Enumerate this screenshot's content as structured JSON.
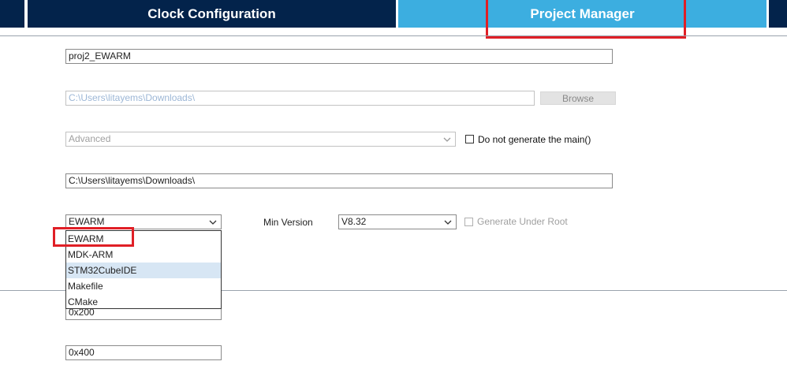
{
  "tabs": {
    "clock_configuration": "Clock Configuration",
    "project_manager": "Project Manager"
  },
  "project": {
    "name": "proj2_EWARM",
    "location": "C:\\Users\\litayems\\Downloads\\",
    "browse_label": "Browse",
    "application_structure": "Advanced",
    "do_not_generate_main_label": "Do not generate the main()",
    "do_not_generate_main_checked": false,
    "toolchain_folder": "C:\\Users\\litayems\\Downloads\\",
    "toolchain_selected": "EWARM",
    "min_version_label": "Min Version",
    "min_version_value": "V8.32",
    "generate_under_root_label": "Generate Under Root",
    "generate_under_root_checked": false,
    "toolchain_options": [
      "EWARM",
      "MDK-ARM",
      "STM32CubeIDE",
      "Makefile",
      "CMake"
    ],
    "hovered_option": "STM32CubeIDE",
    "heap_size": "0x200",
    "stack_size": "0x400"
  },
  "colors": {
    "tab_dark": "#03234b",
    "tab_active": "#3caee0",
    "highlight_red": "#e01f26",
    "hover": "#d7e6f4"
  }
}
